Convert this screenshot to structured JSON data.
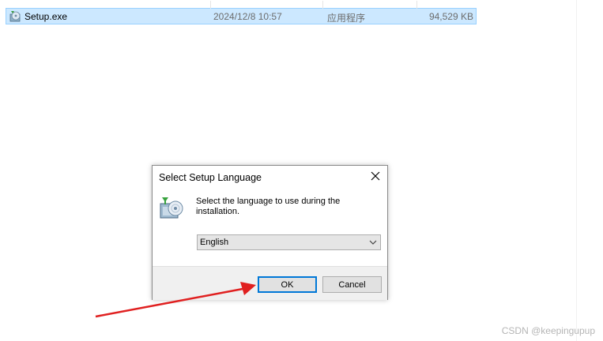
{
  "file": {
    "name": "Setup.exe",
    "date": "2024/12/8 10:57",
    "type": "应用程序",
    "size": "94,529 KB",
    "icon": "installer-icon"
  },
  "dialog": {
    "title": "Select Setup Language",
    "prompt": "Select the language to use during the installation.",
    "language": {
      "selected": "English"
    },
    "ok_label": "OK",
    "cancel_label": "Cancel",
    "icon": "setup-installer-icon"
  },
  "annotation": {
    "arrow_color": "#e02020",
    "target": "ok-button"
  },
  "watermark": "CSDN @keepingupup",
  "colors": {
    "selection_bg": "#cce8ff",
    "selection_border": "#99d1ff",
    "focus_blue": "#0078d7"
  }
}
